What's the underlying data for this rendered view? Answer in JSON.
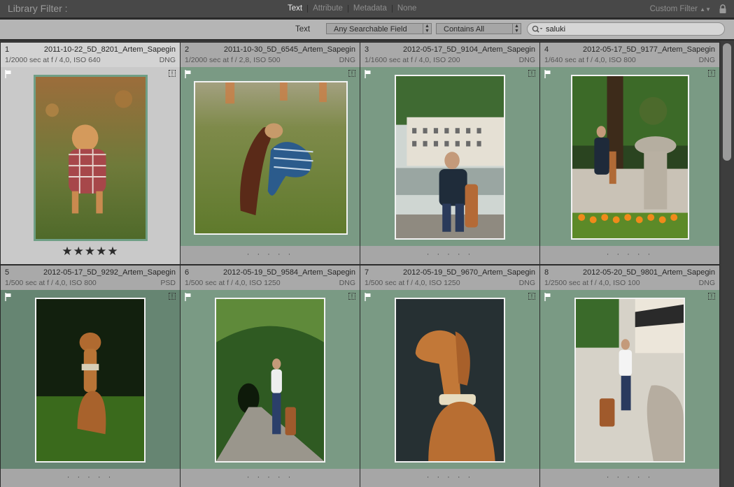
{
  "library_filter": {
    "title": "Library Filter :",
    "options": [
      "Text",
      "Attribute",
      "Metadata",
      "None"
    ],
    "active_option": "Text",
    "custom_filter": "Custom Filter"
  },
  "text_filter": {
    "label": "Text",
    "field": "Any Searchable Field",
    "rule": "Contains All",
    "search_value": "saluki"
  },
  "thumbnails": [
    {
      "index": "1",
      "filename": "2011-10-22_5D_8201_Artem_Sapegin",
      "exif": "1/2000 sec at f / 4,0, ISO 640",
      "format": "DNG",
      "rating": "★★★★★",
      "dots": "· · · · ·"
    },
    {
      "index": "2",
      "filename": "2011-10-30_5D_6545_Artem_Sapegin",
      "exif": "1/2000 sec at f / 2,8, ISO 500",
      "format": "DNG",
      "rating": "",
      "dots": "· · · · ·"
    },
    {
      "index": "3",
      "filename": "2012-05-17_5D_9104_Artem_Sapegin",
      "exif": "1/1600 sec at f / 4,0, ISO 200",
      "format": "DNG",
      "rating": "",
      "dots": "· · · · ·"
    },
    {
      "index": "4",
      "filename": "2012-05-17_5D_9177_Artem_Sapegin",
      "exif": "1/640 sec at f / 4,0, ISO 800",
      "format": "DNG",
      "rating": "",
      "dots": "· · · · ·"
    },
    {
      "index": "5",
      "filename": "2012-05-17_5D_9292_Artem_Sapegin",
      "exif": "1/500 sec at f / 4,0, ISO 800",
      "format": "PSD",
      "rating": "",
      "dots": "· · · · ·"
    },
    {
      "index": "6",
      "filename": "2012-05-19_5D_9584_Artem_Sapegin",
      "exif": "1/500 sec at f / 4,0, ISO 1250",
      "format": "DNG",
      "rating": "",
      "dots": "· · · · ·"
    },
    {
      "index": "7",
      "filename": "2012-05-19_5D_9670_Artem_Sapegin",
      "exif": "1/500 sec at f / 4,0, ISO 1250",
      "format": "DNG",
      "rating": "",
      "dots": "· · · · ·"
    },
    {
      "index": "8",
      "filename": "2012-05-20_5D_9801_Artem_Sapegin",
      "exif": "1/2500 sec at f / 4,0, ISO 100",
      "format": "DNG",
      "rating": "",
      "dots": "· · · · ·"
    }
  ],
  "icons": {
    "lock": "lock-icon",
    "search": "search-icon",
    "flag": "flag-icon",
    "badge": "badge-icon"
  },
  "colors": {
    "grid_bg": "#7a9a84",
    "selected_cell": "#c9c9c9",
    "topbar": "#484848",
    "filterbar": "#b5b5b5"
  }
}
